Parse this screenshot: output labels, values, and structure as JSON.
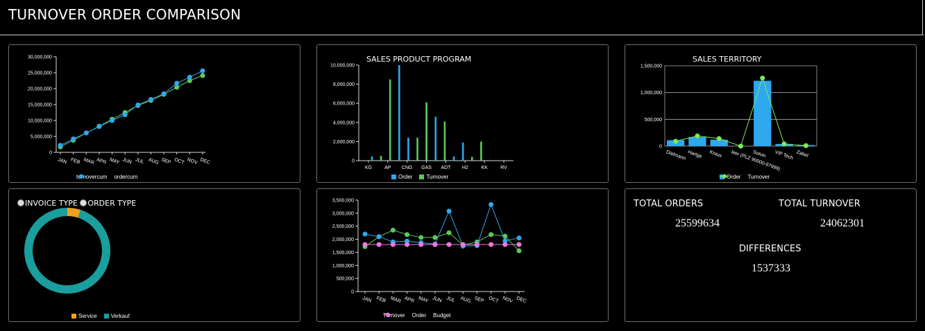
{
  "header": {
    "title": "TURNOVER ORDER COMPARISON"
  },
  "colors": {
    "green": "#5dc95d",
    "blue": "#2ea8ee",
    "pink": "#ee77dd",
    "orange": "#f0a020",
    "teal": "#1a9e9e",
    "lightgreen": "#7eea5a"
  },
  "chart_data": [
    {
      "type": "line",
      "title": "",
      "categories": [
        "JAN",
        "FEB",
        "MAR",
        "APR",
        "MAY",
        "JUN",
        "JUL",
        "AUG",
        "SEP",
        "OCT",
        "NOV",
        "DEC"
      ],
      "y_ticks": [
        "0",
        "5,000,000",
        "10,000,000",
        "15,000,000",
        "20,000,000",
        "25,000,000",
        "30,000,000"
      ],
      "ylim": [
        0,
        30000000
      ],
      "series": [
        {
          "name": "turnovercum",
          "color": "#5dc95d",
          "values": [
            1700000,
            3800000,
            6100000,
            8200000,
            10400000,
            12500000,
            14700000,
            16300000,
            18200000,
            20400000,
            22500000,
            24100000
          ]
        },
        {
          "name": "ordercum",
          "color": "#2ea8ee",
          "values": [
            2200000,
            4200000,
            6100000,
            8100000,
            10000000,
            11800000,
            14900000,
            16600000,
            18400000,
            21700000,
            23600000,
            25600000
          ]
        }
      ]
    },
    {
      "type": "bar",
      "title": "SALES PRODUCT PROGRAM",
      "categories": [
        "KG",
        "AP",
        "CNG",
        "GAS",
        "ADT",
        "H2",
        "KK",
        "RV"
      ],
      "minor_count": 17,
      "y_ticks": [
        "0",
        "2,000,000",
        "4,000,000",
        "6,000,000",
        "8,000,000",
        "10,000,000"
      ],
      "ylim": [
        0,
        10000000
      ],
      "series": [
        {
          "name": "Order",
          "color": "#2ea8ee",
          "values": [
            0,
            450000,
            0,
            0,
            10000000,
            2400000,
            0,
            5800000,
            4600000,
            0,
            450000,
            1900000,
            0,
            0,
            0,
            0,
            0
          ]
        },
        {
          "name": "Turnover",
          "color": "#5dc95d",
          "values": [
            0,
            0,
            500000,
            8500000,
            0,
            0,
            2400000,
            6100000,
            0,
            4100000,
            0,
            0,
            400000,
            2000000,
            0,
            0,
            0
          ]
        }
      ]
    },
    {
      "type": "bar",
      "title": "SALES TERRITORY",
      "categories": [
        "Dielmann",
        "Hartge",
        "Kraus",
        "leer (PLZ 90000-97999)",
        "Solvin",
        "VIP Tech",
        "Zabel"
      ],
      "y_ticks": [
        "0",
        "500,000",
        "1,000,000",
        "1,500,000"
      ],
      "ylim": [
        0,
        1500000
      ],
      "series": [
        {
          "name": "Order",
          "color": "#2ea8ee",
          "values": [
            110000,
            170000,
            120000,
            0,
            1220000,
            40000,
            20000
          ]
        },
        {
          "name": "Turnover",
          "color": "#7eea5a",
          "values": [
            90000,
            190000,
            140000,
            0,
            1270000,
            40000,
            10000
          ]
        }
      ]
    },
    {
      "type": "pie",
      "title": "",
      "categories": [
        "Service",
        "Verkauf"
      ],
      "values": [
        5,
        95
      ]
    },
    {
      "type": "line",
      "title": "",
      "categories": [
        "JAN",
        "FEB",
        "MAR",
        "APR",
        "MAY",
        "JUN",
        "JUL",
        "AUG",
        "SEP",
        "OCT",
        "NOV",
        "DEC"
      ],
      "y_ticks": [
        "0",
        "500,000",
        "1,000,000",
        "1,500,000",
        "2,000,000",
        "2,500,000",
        "3,000,000",
        "3,500,000"
      ],
      "ylim": [
        0,
        3500000
      ],
      "series": [
        {
          "name": "Turnover",
          "color": "#5dc95d",
          "values": [
            1720000,
            2100000,
            2350000,
            2180000,
            2070000,
            2070000,
            2250000,
            1780000,
            1900000,
            2180000,
            2120000,
            1560000
          ]
        },
        {
          "name": "Order",
          "color": "#2ea8ee",
          "values": [
            2200000,
            2100000,
            1900000,
            1930000,
            1870000,
            1820000,
            3080000,
            1740000,
            1760000,
            3330000,
            1940000,
            2050000
          ]
        },
        {
          "name": "Budget",
          "color": "#ee77dd",
          "values": [
            1800000,
            1800000,
            1800000,
            1800000,
            1800000,
            1800000,
            1800000,
            1800000,
            1800000,
            1800000,
            1800000,
            1800000
          ]
        }
      ]
    }
  ],
  "panel_types": {
    "invoice_label": "INVOICE TYPE",
    "order_label": "ORDER TYPE"
  },
  "stats": {
    "orders_label": "TOTAL ORDERS",
    "orders_value": "25599634",
    "turnover_label": "TOTAL TURNOVER",
    "turnover_value": "24062301",
    "diff_label": "DIFFERENCES",
    "diff_value": "1537333"
  }
}
